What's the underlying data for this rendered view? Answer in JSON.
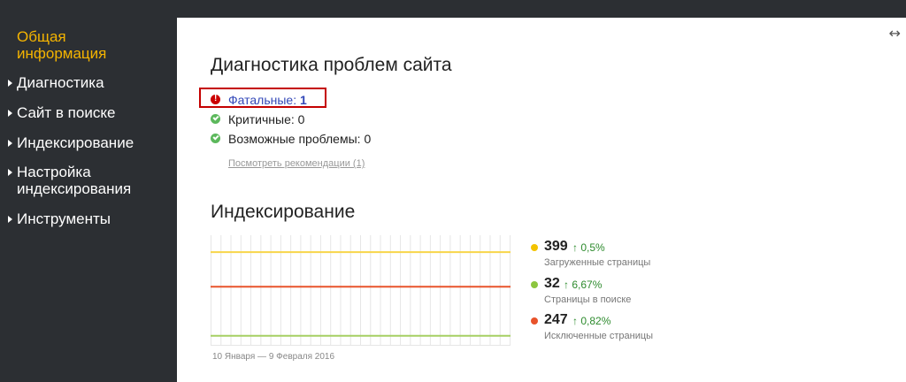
{
  "sidebar": {
    "items": [
      {
        "label": "Общая\nинформация",
        "active": true
      },
      {
        "label": "Диагностика"
      },
      {
        "label": "Сайт в поиске"
      },
      {
        "label": "Индексирование"
      },
      {
        "label": "Настройка\nиндексирования"
      },
      {
        "label": "Инструменты"
      }
    ]
  },
  "header": {
    "expand_icon": "↔"
  },
  "diagnostics": {
    "title": "Диагностика проблем сайта",
    "fatal": {
      "label": "Фатальные:",
      "count": "1"
    },
    "critical": {
      "text": "Критичные: 0"
    },
    "possible": {
      "text": "Возможные проблемы: 0"
    },
    "recommendations_link": "Посмотреть рекомендации (1)"
  },
  "indexing": {
    "title": "Индексирование",
    "date_range": "10 Января — 9 Февраля 2016",
    "stats": [
      {
        "value": "399",
        "delta": "↑ 0,5%",
        "label": "Загруженные страницы",
        "color": "#f3c300"
      },
      {
        "value": "32",
        "delta": "↑ 6,67%",
        "label": "Страницы в поиске",
        "color": "#8cc63f"
      },
      {
        "value": "247",
        "delta": "↑ 0,82%",
        "label": "Исключенные страницы",
        "color": "#e8532b"
      }
    ]
  },
  "chart_data": {
    "type": "line",
    "series": [
      {
        "values": [
          399,
          399,
          399,
          399,
          399,
          399,
          399,
          399,
          399,
          399,
          399,
          399,
          399,
          399,
          399,
          399,
          399,
          399,
          399,
          399,
          399,
          399,
          399,
          399,
          399,
          399,
          399,
          399,
          399,
          399,
          399
        ],
        "color": "#f7d54a"
      },
      {
        "values": [
          247,
          247,
          247,
          247,
          247,
          247,
          247,
          247,
          247,
          247,
          247,
          247,
          247,
          247,
          247,
          247,
          247,
          247,
          247,
          247,
          247,
          247,
          247,
          247,
          247,
          247,
          247,
          247,
          247,
          247,
          247
        ],
        "color": "#e8532b"
      },
      {
        "values": [
          32,
          32,
          32,
          32,
          32,
          32,
          32,
          32,
          32,
          32,
          32,
          32,
          32,
          32,
          32,
          32,
          32,
          32,
          32,
          32,
          32,
          32,
          32,
          32,
          32,
          32,
          32,
          32,
          32,
          32,
          32
        ],
        "color": "#a6cf63"
      }
    ],
    "ylim": [
      0,
      450
    ],
    "grid": true
  }
}
